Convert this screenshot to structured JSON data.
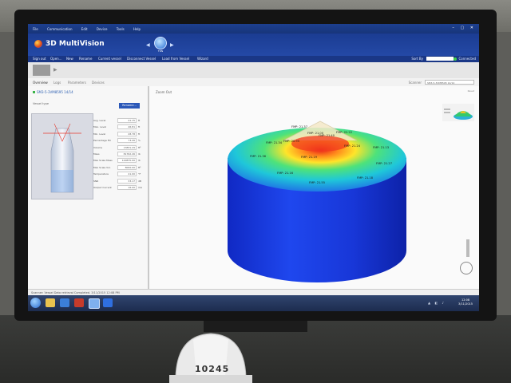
{
  "window": {
    "menu": [
      "File",
      "Communication",
      "Edit",
      "Device",
      "Tools",
      "Help"
    ],
    "controls": "– ▢ ✕"
  },
  "app": {
    "title": "3D MultiVision",
    "vessel_badge": "TRN"
  },
  "toolbar": {
    "items": [
      "Sign out",
      "Open...",
      "New",
      "Rename",
      "Current vessel",
      "Disconnect Vessel",
      "Load from Vessel",
      "Wizard"
    ],
    "sort_label": "Sort By",
    "status": "Connected"
  },
  "tabs": [
    "Overview",
    "Logs",
    "Parameters",
    "Devices"
  ],
  "scanner": {
    "label": "Scanner",
    "value": "SM3-5-3VM8595 14/14"
  },
  "left_panel": {
    "vessel_name": "SM3-5-3VM8595 14/14",
    "section_label": "Vessel type",
    "rename_button": "Rename...",
    "properties": [
      {
        "label": "Avg. Level",
        "value": "41.15",
        "unit": "ft"
      },
      {
        "label": "Max. Level",
        "value": "46.81",
        "unit": "ft"
      },
      {
        "label": "Min. Level",
        "value": "28.78",
        "unit": "ft"
      },
      {
        "label": "Percentage Fill",
        "value": "73.26",
        "unit": "%"
      },
      {
        "label": "Volume",
        "value": "13831.29",
        "unit": "ft³"
      },
      {
        "label": "Mass",
        "value": "81762.26",
        "unit": "lb"
      },
      {
        "label": "Max Scale Mass",
        "value": "100875.00",
        "unit": "lb"
      },
      {
        "label": "Max Scale Vol.",
        "value": "8000.00",
        "unit": "ft³"
      },
      {
        "label": "Temperature",
        "value": "41.00",
        "unit": "°F"
      },
      {
        "label": "SNR",
        "value": "33.17",
        "unit": "dB"
      },
      {
        "label": "Output Current",
        "value": "16.00",
        "unit": "mA"
      }
    ]
  },
  "main_view": {
    "label": "Zoom Out",
    "mini_controls": "Reset",
    "points": [
      "FMP: 21.37",
      "FMP: 21.00",
      "FMP: 22.22",
      "FMP: 21.40",
      "FMP: 20.95",
      "FMP: 21.34",
      "FMP: 21.24",
      "FMP: 21.36",
      "FMP: 21.19",
      "FMP: 21.13",
      "FMP: 21.27",
      "FMP: 21.16",
      "FMP: 21.18",
      "FMP: 21.55"
    ],
    "colors": {
      "low": "#1a3fe0",
      "mid": "#27d3a0",
      "high": "#e8231a",
      "top": "#ffd400"
    }
  },
  "statusbar": {
    "text": "Scanner: Vessel Data retrieval Completed. 3/11/2015 12:08 PM"
  },
  "taskbar": {
    "time": "12:08",
    "date": "3/11/2015"
  },
  "foreground": {
    "hardhat_number": "10245"
  }
}
